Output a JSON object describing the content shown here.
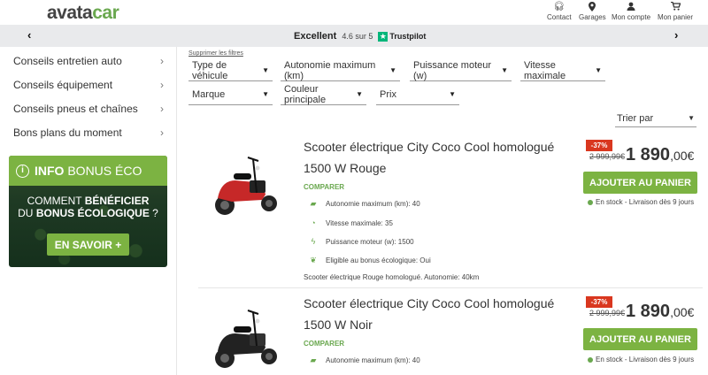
{
  "header": {
    "logo_main": "avata",
    "logo_accent": "car",
    "nav": [
      {
        "label": "Contact",
        "icon": "headset-icon"
      },
      {
        "label": "Garages",
        "icon": "map-pin-icon"
      },
      {
        "label": "Mon compte",
        "icon": "user-icon"
      },
      {
        "label": "Mon panier",
        "icon": "cart-icon"
      }
    ]
  },
  "trustbar": {
    "excellent": "Excellent",
    "rating": "4.6 sur 5",
    "brand": "Trustpilot",
    "prev": "‹",
    "next": "›"
  },
  "sidebar": {
    "items": [
      {
        "label": "Conseils entretien auto"
      },
      {
        "label": "Conseils équipement"
      },
      {
        "label": "Conseils pneus et chaînes"
      },
      {
        "label": "Bons plans du moment"
      }
    ],
    "promo": {
      "title_bold": "INFO",
      "title_rest": "BONUS ÉCO",
      "line1_a": "COMMENT ",
      "line1_b": "BÉNÉFICIER",
      "line2_a": "DU ",
      "line2_b": "BONUS ÉCOLOGIQUE",
      "line2_c": " ?",
      "button": "EN SAVOIR +"
    }
  },
  "filters": {
    "clear": "Supprimer les filtres",
    "items": [
      "Type de véhicule",
      "Autonomie maximum (km)",
      "Puissance moteur (w)",
      "Vitesse maximale",
      "Marque",
      "Couleur principale",
      "Prix"
    ],
    "sort": "Trier par"
  },
  "products": [
    {
      "title": "Scooter électrique City Coco Cool homologué 1500 W Rouge",
      "compare": "COMPARER",
      "specs": [
        "Autonomie maximum (km): 40",
        "Vitesse maximale: 35",
        "Puissance moteur (w): 1500",
        "Eligible au bonus écologique: Oui"
      ],
      "description": "Scooter électrique Rouge homologué. Autonomie: 40km",
      "discount": "-37%",
      "old_price": "2 999,99€",
      "price_int": "1 890",
      "price_cents": ",00€",
      "cart": "AJOUTER AU PANIER",
      "stock": "En stock - Livraison dès 9 jours",
      "color": "#c62828"
    },
    {
      "title": "Scooter électrique City Coco Cool homologué 1500 W Noir",
      "compare": "COMPARER",
      "specs": [
        "Autonomie maximum (km): 40"
      ],
      "discount": "-37%",
      "old_price": "2 999,99€",
      "price_int": "1 890",
      "price_cents": ",00€",
      "cart": "AJOUTER AU PANIER",
      "stock": "En stock - Livraison dès 9 jours",
      "color": "#222222"
    }
  ]
}
